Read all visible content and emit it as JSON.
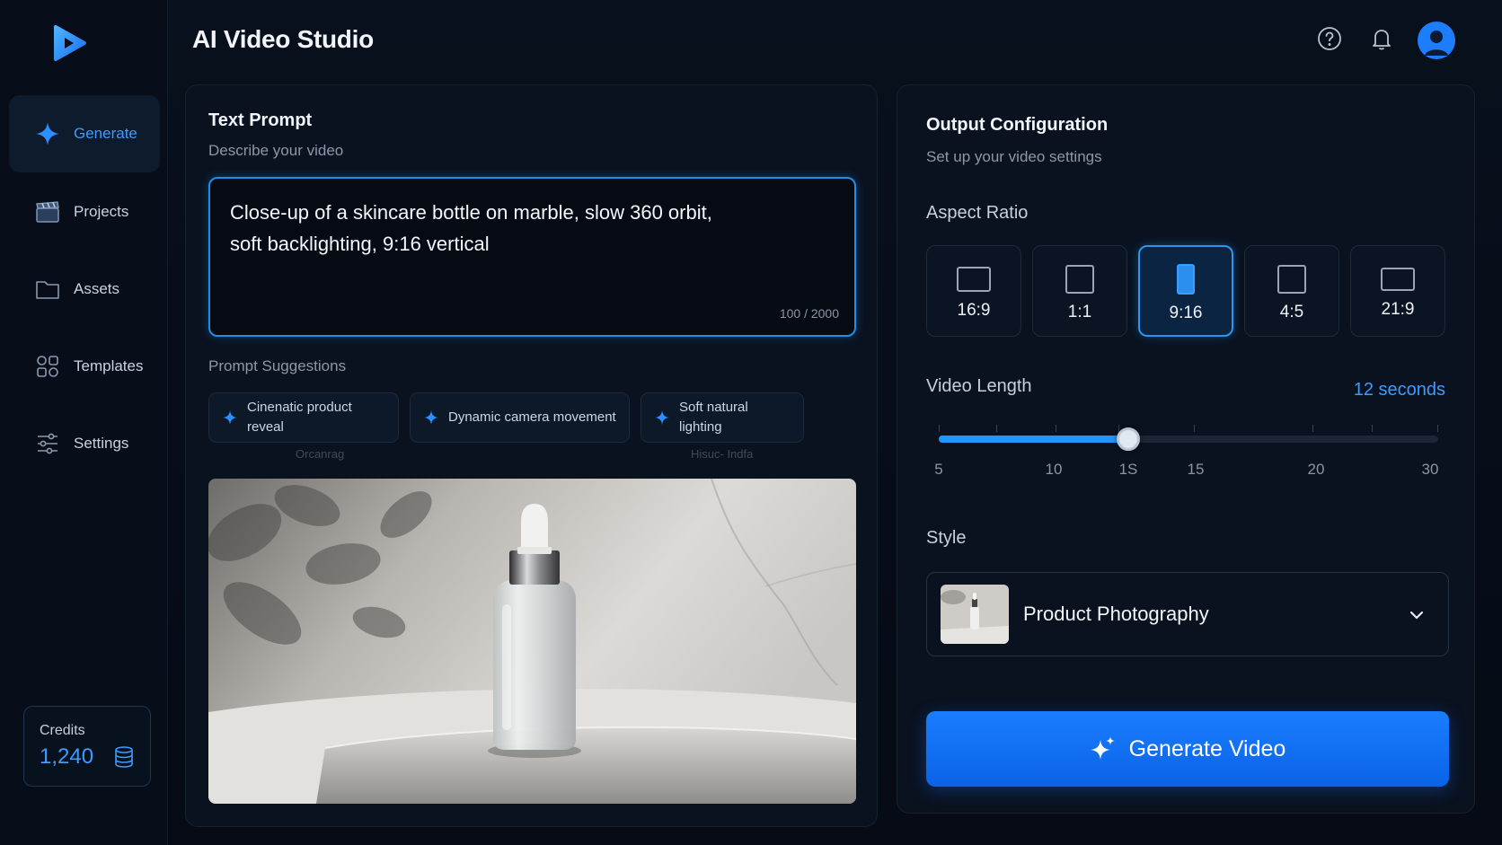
{
  "app": {
    "title": "AI Video Studio"
  },
  "sidebar": {
    "items": [
      {
        "label": "Generate",
        "icon": "sparkle-icon"
      },
      {
        "label": "Projects",
        "icon": "clapperboard-icon"
      },
      {
        "label": "Assets",
        "icon": "folder-icon"
      },
      {
        "label": "Templates",
        "icon": "templates-icon"
      },
      {
        "label": "Settings",
        "icon": "sliders-icon"
      }
    ],
    "credits": {
      "label": "Credits",
      "value": "1,240"
    }
  },
  "prompt": {
    "heading": "Text Prompt",
    "subheading": "Describe your video",
    "value_line1": "Close-up of a skincare bottle on marble, slow 360 orbit,",
    "value_line2": "soft backlighting, 9:16 vertical",
    "counter": "100 / 2000"
  },
  "suggestions": {
    "heading": "Prompt Suggestions",
    "items": [
      {
        "label_line1": "Cinenatic product",
        "label_line2": "reveal"
      },
      {
        "label_line1": "Dynamic camera movement",
        "label_line2": ""
      },
      {
        "label_line1": "Soft natural lighting",
        "label_line2": ""
      }
    ],
    "ghost_text_1": "Orcanrag",
    "ghost_text_2": "Hisuc- Indfa"
  },
  "output": {
    "heading": "Output Configuration",
    "subheading": "Set up your video settings",
    "aspect_heading": "Aspect Ratio",
    "aspect_ratios": [
      "16:9",
      "1:1",
      "9:16",
      "4:5",
      "21:9"
    ],
    "selected_aspect": "9:16",
    "length_heading": "Video Length",
    "length_value": "12 seconds",
    "slider_fraction": 0.38,
    "tick_labels": [
      "5",
      "10",
      "1S",
      "15",
      "20",
      "30"
    ],
    "style_heading": "Style",
    "style_value": "Product Photography",
    "generate_label": "Generate Video"
  },
  "colors": {
    "accent": "#1d7dff",
    "background": "#070d18"
  }
}
